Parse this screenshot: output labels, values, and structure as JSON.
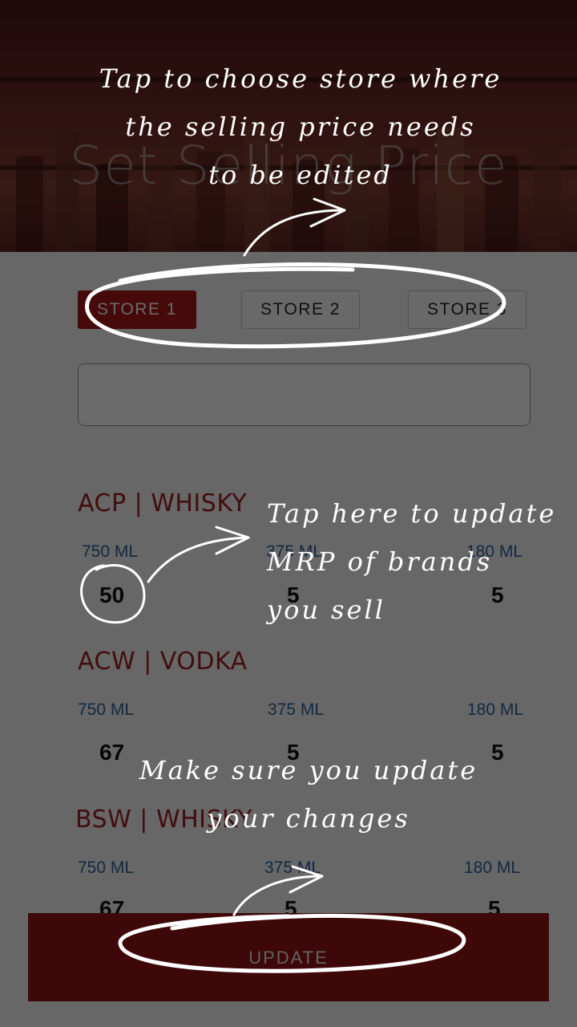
{
  "header": {
    "title": "Set Selling Price"
  },
  "stores": [
    {
      "label": "STORE 1",
      "active": true
    },
    {
      "label": "STORE 2",
      "active": false
    },
    {
      "label": "STORE 3",
      "active": false
    }
  ],
  "search": {
    "placeholder": ""
  },
  "brands": [
    {
      "name": "ACP | WHISKY",
      "sizes": [
        "750 ML",
        "375 ML",
        "180 ML"
      ],
      "prices": [
        "50",
        "5",
        "5"
      ]
    },
    {
      "name": "ACW | VODKA",
      "sizes": [
        "750 ML",
        "375 ML",
        "180 ML"
      ],
      "prices": [
        "67",
        "5",
        "5"
      ]
    },
    {
      "name": "BSW | WHISKY",
      "sizes": [
        "750 ML",
        "375 ML",
        "180 ML"
      ],
      "prices": [
        "67",
        "5",
        "5"
      ]
    }
  ],
  "update_button": {
    "label": "UPDATE"
  },
  "coach_marks": {
    "store_hint": [
      "Tap to choose store where",
      "the selling price needs",
      "to be edited"
    ],
    "mrp_hint": [
      "Tap here to update",
      "MRP of brands",
      "you sell"
    ],
    "update_hint": [
      "Make sure you update",
      "your changes"
    ]
  },
  "colors": {
    "accent": "#a01818",
    "brand_text": "#9a1e20",
    "size_text": "#2c5d96",
    "overlay": "rgba(0,0,0,0.56)"
  },
  "icons": [
    "arrow-icon",
    "circle-highlight-icon"
  ]
}
